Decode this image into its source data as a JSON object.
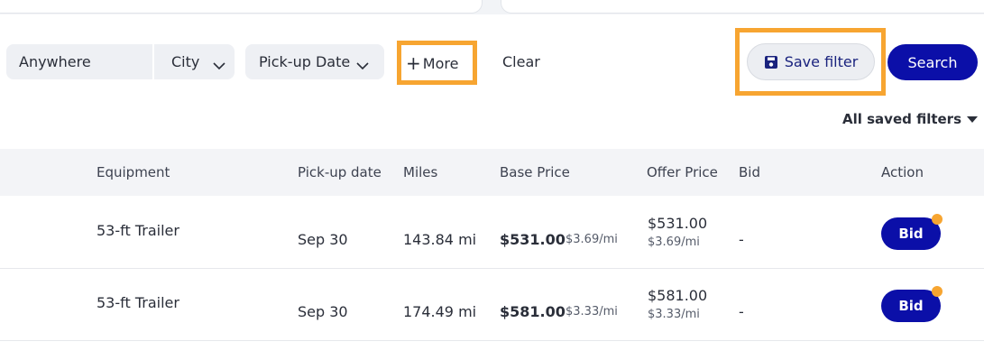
{
  "filters": {
    "location_label": "Anywhere",
    "city_label": "City",
    "pickup_label": "Pick-up Date",
    "more_label": "More",
    "clear_label": "Clear",
    "save_label": "Save filter",
    "search_label": "Search",
    "saved_filters_label": "All saved filters"
  },
  "table": {
    "headers": [
      "Equipment",
      "Pick-up date",
      "Miles",
      "Base Price",
      "Offer Price",
      "Bid",
      "Action"
    ],
    "rows": [
      {
        "equipment": "53-ft Trailer",
        "pickup": "Sep 30",
        "miles": "143.84 mi",
        "base_price": "$531.00",
        "base_rate": "$3.69/mi",
        "offer_price": "$531.00",
        "offer_rate": "$3.69/mi",
        "bid": "-",
        "action": "Bid"
      },
      {
        "equipment": "53-ft Trailer",
        "pickup": "Sep 30",
        "miles": "174.49 mi",
        "base_price": "$581.00",
        "base_rate": "$3.33/mi",
        "offer_price": "$581.00",
        "offer_rate": "$3.33/mi",
        "bid": "-",
        "action": "Bid"
      }
    ]
  },
  "colors": {
    "primary": "#0b0fa8",
    "highlight": "#f7a531",
    "pill_bg": "#eef0f4",
    "header_bg": "#f3f4f7"
  },
  "icons": {
    "save": "floppy-disk-icon",
    "chevron": "chevron-down-icon",
    "plus": "plus-icon",
    "caret": "caret-down-icon"
  }
}
